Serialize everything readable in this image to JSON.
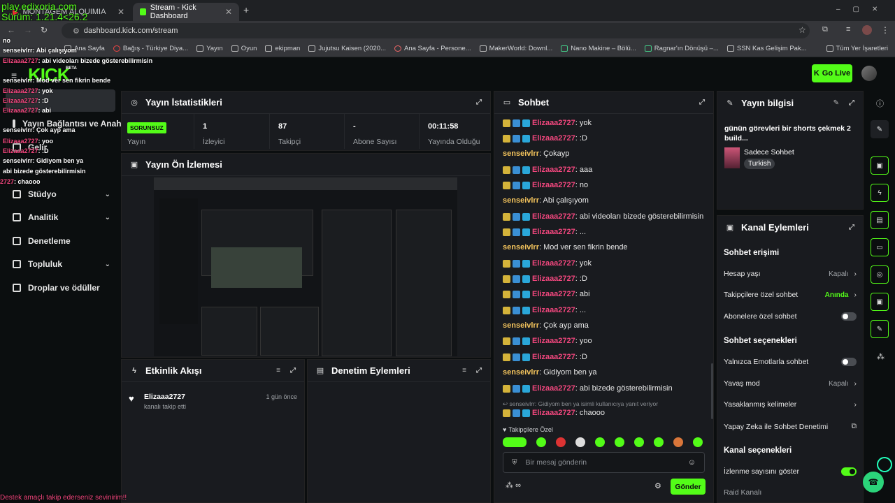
{
  "browser": {
    "tabs": [
      {
        "title": "MONTAGEM ALQUIMIA - Yo"
      },
      {
        "title": "Stream - Kick Dashboard"
      }
    ],
    "url": "dashboard.kick.com/stream",
    "bookmarks": [
      "Ana Sayfa",
      "Bağış - Türkiye Diya...",
      "Yayın",
      "Oyun",
      "ekipman",
      "Jujutsu Kaisen (2020...",
      "Ana Sayfa - Persone...",
      "MakerWorld: Downl...",
      "Nano Makine – Bölü...",
      "Ragnar'ın Dönüşü –...",
      "SSN Kas Gelişim Pak..."
    ],
    "all_bookmarks": "Tüm Yer İşaretleri"
  },
  "overlay": {
    "server": "play.edixoria.com",
    "version": "Sürüm: 1.21.4<26.2",
    "footer": "Destek amaçlı takip ederseniz sevinirim!!",
    "chat_lines": [
      {
        "user": "",
        "text": "no"
      },
      {
        "user": "senseivlrr",
        "text": ": Abi çalışıyom"
      },
      {
        "user": "Elizaaa2727",
        "text": ": abi videoları bizede gösterebilirmisin"
      },
      {
        "user": "senseivlrr",
        "text": ": Mod ver sen fikrin bende"
      },
      {
        "user": "Elizaaa2727",
        "text": ": yok"
      },
      {
        "user": "Elizaaa2727",
        "text": ": :D"
      },
      {
        "user": "Elizaaa2727",
        "text": ": abi"
      },
      {
        "user": "senseivlrr",
        "text": ": Çok ayp ama"
      },
      {
        "user": "Elizaaa2727",
        "text": ": yoo"
      },
      {
        "user": "Elizaaa2727",
        "text": ": :D"
      },
      {
        "user": "senseivlrr",
        "text": ": Gidiyom ben ya"
      },
      {
        "user": "",
        "text": "abi bizede gösterebilirmisin"
      },
      {
        "user": "2727",
        "text": ": chaooo"
      }
    ]
  },
  "app": {
    "logo": "KICK",
    "beta": "BETA",
    "go_live": "Go Live"
  },
  "sidebar": {
    "items": [
      {
        "label": "Yayın Bağlantısı ve Anahta"
      },
      {
        "label": "Gelir"
      },
      {
        "label": "Stüdyo"
      },
      {
        "label": "Analitik"
      },
      {
        "label": "Denetleme"
      },
      {
        "label": "Topluluk"
      },
      {
        "label": "Droplar ve ödüller"
      }
    ]
  },
  "stats": {
    "title": "Yayın İstatistikleri",
    "status_badge": "SORUNSUZ",
    "cells": [
      {
        "value": "",
        "label": "Yayın"
      },
      {
        "value": "1",
        "label": "İzleyici"
      },
      {
        "value": "87",
        "label": "Takipçi"
      },
      {
        "value": "-",
        "label": "Abone Sayısı"
      },
      {
        "value": "00:11:58",
        "label": "Yayında Olduğu"
      }
    ]
  },
  "preview": {
    "title": "Yayın Ön İzlemesi"
  },
  "activity": {
    "title": "Etkinlik Akışı",
    "items": [
      {
        "user": "Elizaaa2727",
        "action": "kanalı takip etti",
        "time": "1 gün önce"
      }
    ]
  },
  "moderation": {
    "title": "Denetim Eylemleri"
  },
  "chat": {
    "title": "Sohbet",
    "messages": [
      {
        "user": "Elizaaa2727",
        "text": ": yok",
        "kind": "u1"
      },
      {
        "user": "Elizaaa2727",
        "text": ": :D",
        "kind": "u1"
      },
      {
        "user": "senseivlrr",
        "text": ": Çokayp",
        "kind": "u2"
      },
      {
        "user": "Elizaaa2727",
        "text": ": aaa",
        "kind": "u1"
      },
      {
        "user": "Elizaaa2727",
        "text": ": no",
        "kind": "u1"
      },
      {
        "user": "senseivlrr",
        "text": ": Abi çalışıyom",
        "kind": "u2"
      },
      {
        "user": "Elizaaa2727",
        "text": ": abi videoları bizede gösterebilirmisin",
        "kind": "u1"
      },
      {
        "user": "Elizaaa2727",
        "text": ": ...",
        "kind": "u1"
      },
      {
        "user": "senseivlrr",
        "text": ": Mod ver sen fikrin bende",
        "kind": "u2"
      },
      {
        "user": "Elizaaa2727",
        "text": ": yok",
        "kind": "u1"
      },
      {
        "user": "Elizaaa2727",
        "text": ": :D",
        "kind": "u1"
      },
      {
        "user": "Elizaaa2727",
        "text": ": abi",
        "kind": "u1"
      },
      {
        "user": "Elizaaa2727",
        "text": ": ...",
        "kind": "u1"
      },
      {
        "user": "senseivlrr",
        "text": ": Çok ayp ama",
        "kind": "u2"
      },
      {
        "user": "Elizaaa2727",
        "text": ": yoo",
        "kind": "u1"
      },
      {
        "user": "Elizaaa2727",
        "text": ": :D",
        "kind": "u1"
      },
      {
        "user": "senseivlrr",
        "text": ": Gidiyom ben ya",
        "kind": "u2"
      },
      {
        "user": "Elizaaa2727",
        "text": ": abi bizede gösterebilirmisin",
        "kind": "u1"
      }
    ],
    "reply_note": "↩ senseivlrr: Gidiyom ben ya isimli kullanıcıya yanıt veriyor",
    "last": {
      "user": "Elizaaa2727",
      "text": ": chaooo"
    },
    "followers_only": "Takipçilere Özel",
    "input_placeholder": "Bir mesaj gönderin",
    "infinity": "∞",
    "send": "Gönder"
  },
  "stream_info": {
    "title": "Yayın bilgisi",
    "stream_title": "günün görevleri bir shorts çekmek 2 build...",
    "category": "Sadece Sohbet",
    "language": "Turkish"
  },
  "channel_actions": {
    "title": "Kanal Eylemleri",
    "chat_access": "Sohbet erişimi",
    "account_age": {
      "label": "Hesap yaşı",
      "value": "Kapalı"
    },
    "followers_chat": {
      "label": "Takipçilere özel sohbet",
      "value": "Anında"
    },
    "subs_chat": {
      "label": "Abonelere özel sohbet"
    },
    "chat_options": "Sohbet seçenekleri",
    "emotes_only": {
      "label": "Yalnızca Emotlarla sohbet"
    },
    "slow_mode": {
      "label": "Yavaş mod",
      "value": "Kapalı"
    },
    "banned_words": {
      "label": "Yasaklanmış kelimeler"
    },
    "ai_mod": {
      "label": "Yapay Zeka ile Sohbet Denetimi"
    },
    "channel_options": "Kanal seçenekleri",
    "show_views": {
      "label": "İzlenme sayısını göster"
    },
    "raid": {
      "label": "Raid Kanalı"
    }
  },
  "colors": {
    "accent": "#53fc18",
    "user_pink": "#f2477e",
    "user_gold": "#f5c55d"
  }
}
